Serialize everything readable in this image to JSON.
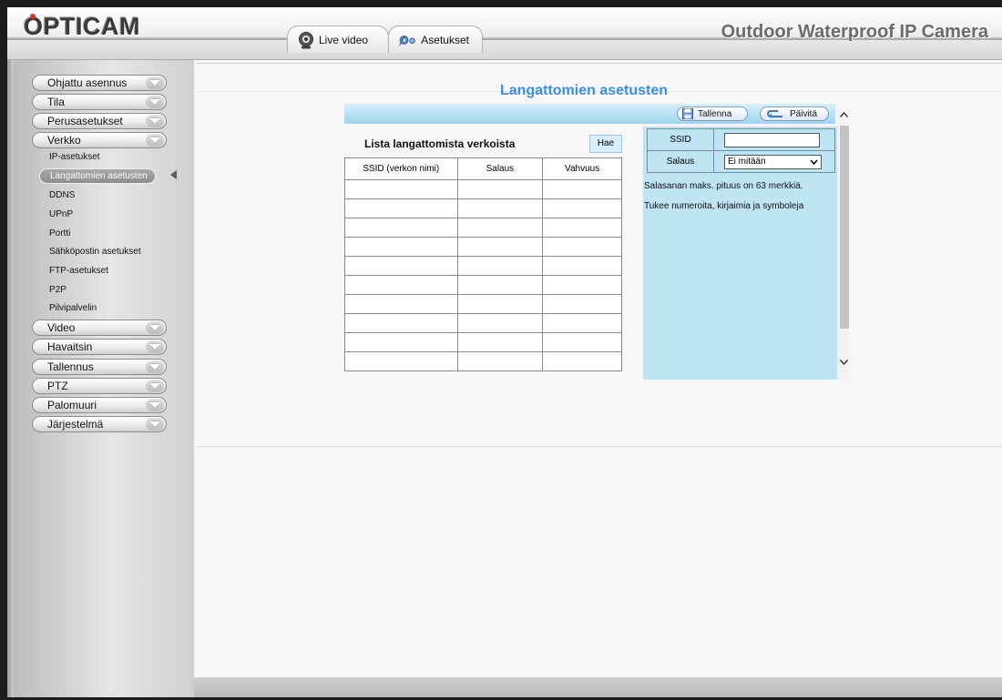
{
  "header": {
    "logo": "OPTICAM",
    "product_title": "Outdoor Waterproof IP Camera",
    "tabs": [
      {
        "label": "Live video",
        "icon": "webcam-icon"
      },
      {
        "label": "Asetukset",
        "icon": "gears-icon"
      }
    ]
  },
  "sidebar": {
    "menu": [
      {
        "label": "Ohjattu asennus"
      },
      {
        "label": "Tila"
      },
      {
        "label": "Perusasetukset"
      },
      {
        "label": "Verkko"
      },
      {
        "label": "Video"
      },
      {
        "label": "Havaitsin"
      },
      {
        "label": "Tallennus"
      },
      {
        "label": "PTZ"
      },
      {
        "label": "Palomuuri"
      },
      {
        "label": "Järjestelmä"
      }
    ],
    "submenu": [
      {
        "label": "IP-asetukset"
      },
      {
        "label": "Langattomien asetusten"
      },
      {
        "label": "DDNS"
      },
      {
        "label": "UPnP"
      },
      {
        "label": "Portti"
      },
      {
        "label": "Sähköpostin asetukset"
      },
      {
        "label": "FTP-asetukset"
      },
      {
        "label": "P2P"
      },
      {
        "label": "Pilvipalvelin"
      }
    ],
    "active_submenu": "Langattomien asetusten"
  },
  "main": {
    "page_title": "Langattomien asetusten",
    "toolbar": {
      "save_label": "Tallenna",
      "refresh_label": "Päivitä"
    },
    "list": {
      "title": "Lista langattomista verkoista",
      "search_label": "Hae",
      "columns": [
        "SSID (verkon nimi)",
        "Salaus",
        "Vahvuus"
      ],
      "rows": 10
    },
    "form": {
      "ssid_label": "SSID",
      "ssid_value": "",
      "security_label": "Salaus",
      "security_value": "Ei mitään",
      "note_length": "Salasanan maks. pituus on 63 merkkiä.",
      "note_chars": "Tukee numeroita, kirjaimia ja symboleja"
    }
  },
  "colors": {
    "title_blue": "#3d8fdc",
    "panel_blue": "#bfe5f4",
    "toolbar_blue": "#9ed5ee"
  }
}
